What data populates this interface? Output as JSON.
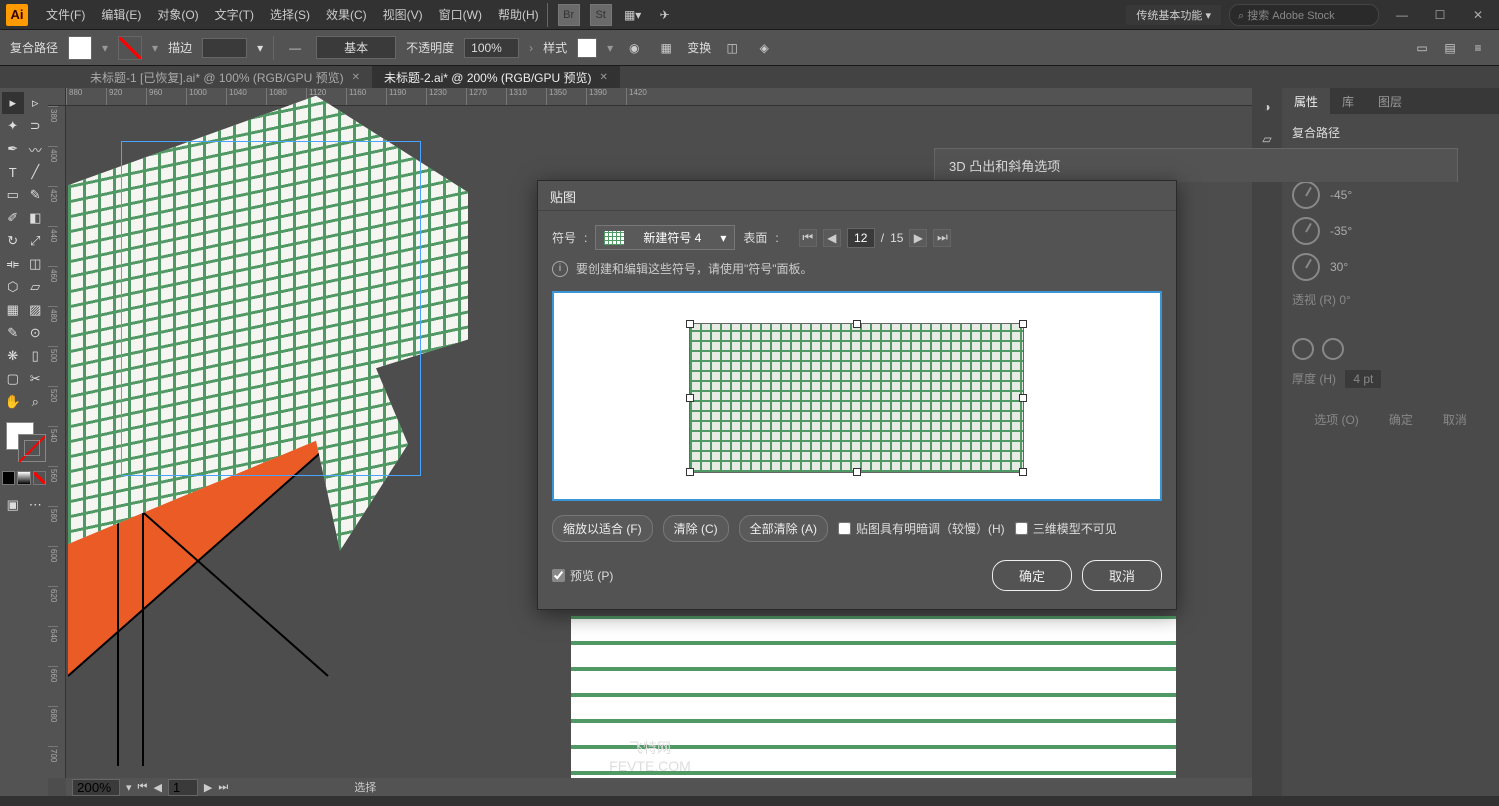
{
  "menu": [
    "文件(F)",
    "编辑(E)",
    "对象(O)",
    "文字(T)",
    "选择(S)",
    "效果(C)",
    "视图(V)",
    "窗口(W)",
    "帮助(H)"
  ],
  "top_icons": [
    "Br",
    "St"
  ],
  "workspace": "传统基本功能",
  "search_placeholder": "搜索 Adobe Stock",
  "control": {
    "path_label": "复合路径",
    "stroke_label": "描边",
    "style_select": "基本",
    "opacity_label": "不透明度",
    "opacity_value": "100%",
    "style_label": "样式",
    "transform_label": "变换"
  },
  "tabs": [
    {
      "label": "未标题-1 [已恢复].ai* @ 100% (RGB/GPU 预览)",
      "active": false
    },
    {
      "label": "未标题-2.ai* @ 200% (RGB/GPU 预览)",
      "active": true
    }
  ],
  "ruler_h": [
    "880",
    "920",
    "960",
    "1000",
    "1040",
    "1080",
    "1120",
    "1160",
    "1190",
    "1230",
    "1270",
    "1310",
    "1350",
    "1390",
    "1420"
  ],
  "ruler_v": [
    "380",
    "400",
    "420",
    "440",
    "460",
    "480",
    "500",
    "520",
    "540",
    "560",
    "580",
    "600",
    "620",
    "640",
    "660",
    "680",
    "700"
  ],
  "statusbar": {
    "zoom": "200%",
    "page": "1",
    "tool": "选择"
  },
  "panel_tabs": [
    "属性",
    "库",
    "图层"
  ],
  "panel_subtitle": "复合路径",
  "angles": [
    "-45°",
    "-35°",
    "30°"
  ],
  "perspective": {
    "label": "透视 (R)",
    "value": "0°"
  },
  "stroke_weight": {
    "label": "厚度 (H)",
    "value": "4 pt"
  },
  "prop_buttons": [
    "选项 (O)",
    "确定",
    "取消"
  ],
  "dialog_3d_title": "3D 凸出和斜角选项",
  "dialog_map": {
    "title": "贴图",
    "symbol_label": "符号",
    "symbol_value": "新建符号 4",
    "surface_label": "表面",
    "surface_current": "12",
    "surface_total": "15",
    "info": "要创建和编辑这些符号，请使用\"符号\"面板。",
    "btn_fit": "缩放以适合 (F)",
    "btn_clear": "清除 (C)",
    "btn_clear_all": "全部清除 (A)",
    "chk_shade": "贴图具有明暗调（较慢）(H)",
    "chk_invisible": "三维模型不可见",
    "chk_preview": "预览 (P)",
    "btn_ok": "确定",
    "btn_cancel": "取消"
  },
  "watermark": {
    "line1": "飞特网",
    "line2": "FEVTE.COM"
  }
}
